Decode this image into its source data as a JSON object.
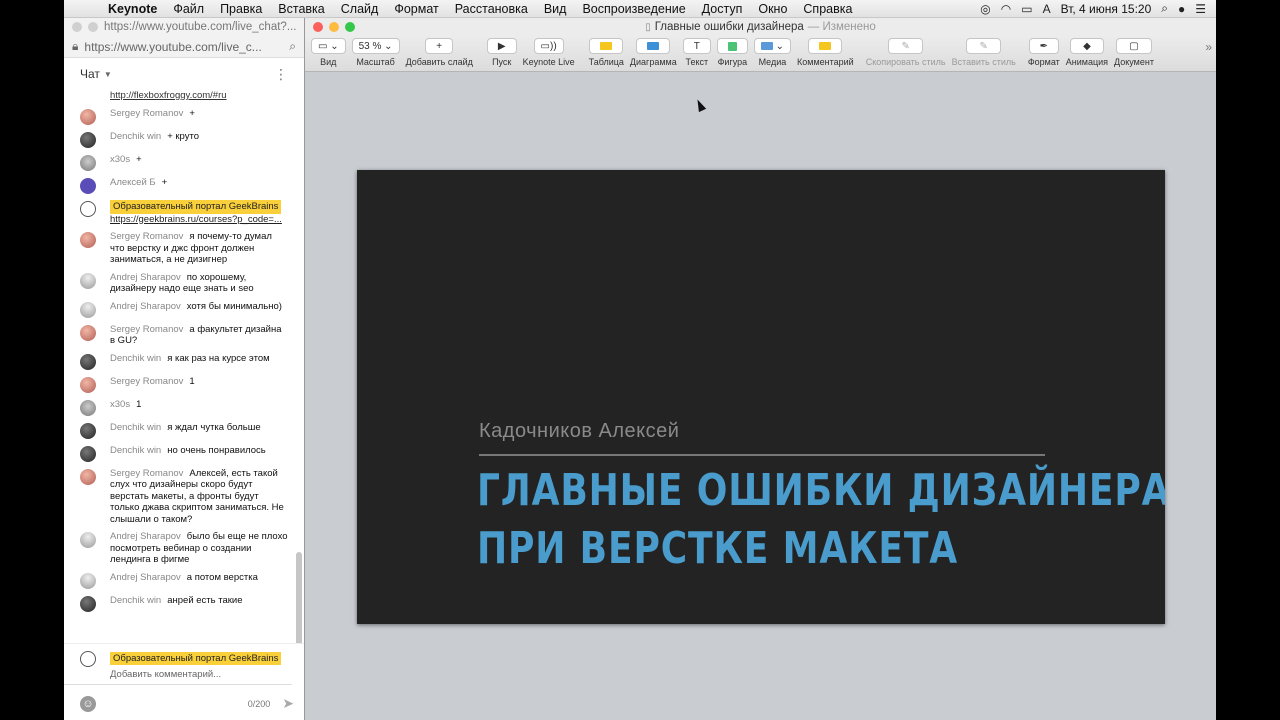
{
  "menubar": {
    "apple": "",
    "app": "Keynote",
    "items": [
      "Файл",
      "Правка",
      "Вставка",
      "Слайд",
      "Формат",
      "Расстановка",
      "Вид",
      "Воспроизведение",
      "Доступ",
      "Окно",
      "Справка"
    ],
    "clock": "Вт, 4 июня  15:20",
    "input_source": "A"
  },
  "browser": {
    "title": "https://www.youtube.com/live_chat?...",
    "url": "https://www.youtube.com/live_c..."
  },
  "chat": {
    "header": "Чат",
    "top_link": "http://flexboxfroggy.com/#ru",
    "messages": [
      {
        "avatar": "pink",
        "author": "Sergey Romanov",
        "text": "+"
      },
      {
        "avatar": "dark",
        "author": "Denchik win",
        "text": "+ круто"
      },
      {
        "avatar": "gray",
        "author": "x30s",
        "text": "+"
      },
      {
        "avatar": "purple",
        "author": "Алексей Б",
        "text": "+"
      },
      {
        "avatar": "gb",
        "author": "Образовательный портал GeekBrains",
        "owner": true,
        "text": "https://geekbrains.ru/courses?p_code=...",
        "link": true
      },
      {
        "avatar": "pink",
        "author": "Sergey Romanov",
        "text": "я почему-то думал что верстку и джс фронт должен заниматься, а не дизигнер"
      },
      {
        "avatar": "man",
        "author": "Andrej Sharapov",
        "text": "по хорошему, дизайнеру надо еще знать и seo"
      },
      {
        "avatar": "man",
        "author": "Andrej Sharapov",
        "text": "хотя бы минимально)"
      },
      {
        "avatar": "pink",
        "author": "Sergey Romanov",
        "text": "а факультет дизайна в GU?"
      },
      {
        "avatar": "dark",
        "author": "Denchik win",
        "text": "я как раз на курсе этом"
      },
      {
        "avatar": "pink",
        "author": "Sergey Romanov",
        "text": "1"
      },
      {
        "avatar": "gray",
        "author": "x30s",
        "text": "1"
      },
      {
        "avatar": "dark",
        "author": "Denchik win",
        "text": "я ждал чутка больше"
      },
      {
        "avatar": "dark",
        "author": "Denchik win",
        "text": "но очень понравилось"
      },
      {
        "avatar": "pink",
        "author": "Sergey Romanov",
        "text": "Алексей, есть такой слух что дизайнеры скоро будут верстать макеты, а фронты будут только джава скриптом заниматься. Не слышали о таком?"
      },
      {
        "avatar": "man",
        "author": "Andrej Sharapov",
        "text": "было бы еще не плохо посмотреть вебинар о создании лендинга в фигме"
      },
      {
        "avatar": "man",
        "author": "Andrej Sharapov",
        "text": "а потом верстка"
      },
      {
        "avatar": "dark",
        "author": "Denchik win",
        "text": "анрей есть такие"
      }
    ],
    "input": {
      "channel": "Образовательный портал GeekBrains",
      "placeholder": "Добавить комментарий...",
      "counter": "0/200"
    }
  },
  "keynote": {
    "doc_title": "Главные ошибки дизайнера",
    "doc_status": "— Изменено",
    "toolbar": [
      {
        "id": "view",
        "label": "Вид",
        "glyph": "▭ ⌄"
      },
      {
        "id": "zoom",
        "label": "Масштаб",
        "glyph": "53 % ⌄"
      },
      {
        "id": "add-slide",
        "label": "Добавить слайд",
        "glyph": "+"
      },
      {
        "id": "play",
        "label": "Пуск",
        "glyph": "▶"
      },
      {
        "id": "keynote-live",
        "label": "Keynote Live",
        "glyph": "▭))"
      },
      {
        "id": "table",
        "label": "Таблица",
        "glyph": ""
      },
      {
        "id": "chart",
        "label": "Диаграмма",
        "glyph": ""
      },
      {
        "id": "text",
        "label": "Текст",
        "glyph": "T"
      },
      {
        "id": "shape",
        "label": "Фигура",
        "glyph": ""
      },
      {
        "id": "media",
        "label": "Медиа",
        "glyph": "⌄"
      },
      {
        "id": "comment",
        "label": "Комментарий",
        "glyph": ""
      },
      {
        "id": "copy-style",
        "label": "Скопировать стиль",
        "glyph": "✎"
      },
      {
        "id": "paste-style",
        "label": "Вставить стиль",
        "glyph": "✎"
      },
      {
        "id": "format",
        "label": "Формат",
        "glyph": "✒"
      },
      {
        "id": "animate",
        "label": "Анимация",
        "glyph": "◆"
      },
      {
        "id": "document",
        "label": "Документ",
        "glyph": "▢"
      }
    ],
    "slide": {
      "author": "Кадочников Алексей",
      "headline_line1": "ГЛАВНЫЕ ОШИБКИ ДИЗАЙНЕРА",
      "headline_line2": "ПРИ ВЕРСТКЕ МАКЕТА"
    }
  },
  "colors": {
    "accent_blue": "#4a9ccd",
    "owner_highlight": "#f9cf3a",
    "slide_bg": "#232323",
    "canvas_bg": "#c9cdd2"
  }
}
